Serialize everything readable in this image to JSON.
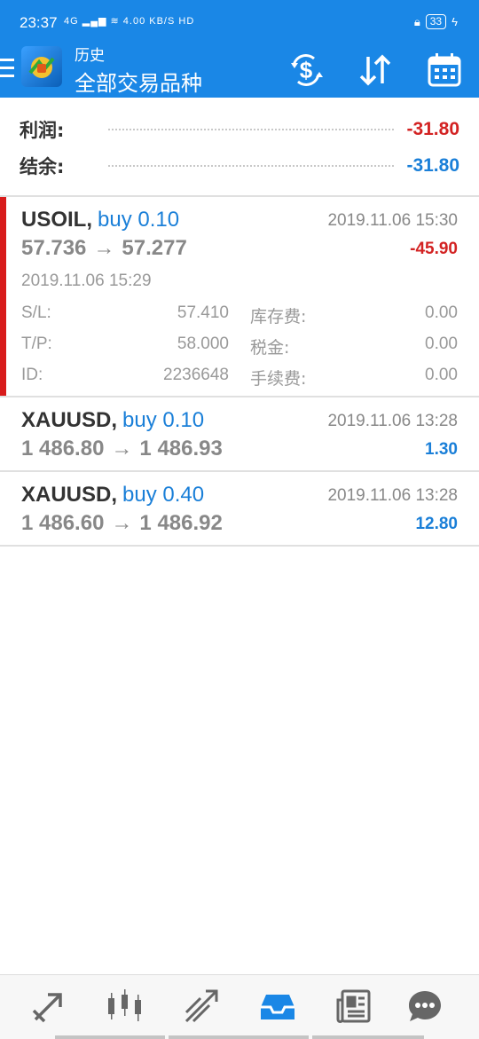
{
  "status_bar": {
    "time": "23:37",
    "net": "4G",
    "speed": "4.00 KB/S",
    "hd": "HD",
    "battery": "33"
  },
  "app_bar": {
    "subtitle": "历史",
    "title": "全部交易品种"
  },
  "icons": {
    "menu": "menu-icon",
    "logo": "metatrader-logo-icon",
    "currency": "currency-exchange-icon",
    "sort": "sort-arrows-icon",
    "calendar": "calendar-icon"
  },
  "summary": {
    "profit_label": "利润:",
    "profit_value": "-31.80",
    "balance_label": "结余:",
    "balance_value": "-31.80"
  },
  "trades": [
    {
      "symbol": "USOIL,",
      "type": "buy 0.10",
      "close_time": "2019.11.06 15:30",
      "open_price": "57.736",
      "arrow": "→",
      "close_price": "57.277",
      "profit": "-45.90",
      "expanded": true,
      "open_time": "2019.11.06 15:29",
      "sl_label": "S/L:",
      "sl_value": "57.410",
      "tp_label": "T/P:",
      "tp_value": "58.000",
      "id_label": "ID:",
      "id_value": "2236648",
      "swap_label": "库存费:",
      "swap_value": "0.00",
      "tax_label": "税金:",
      "tax_value": "0.00",
      "commission_label": "手续费:",
      "commission_value": "0.00"
    },
    {
      "symbol": "XAUUSD,",
      "type": "buy 0.10",
      "close_time": "2019.11.06 13:28",
      "open_price": "1 486.80",
      "arrow": "→",
      "close_price": "1 486.93",
      "profit": "1.30",
      "expanded": false
    },
    {
      "symbol": "XAUUSD,",
      "type": "buy 0.40",
      "close_time": "2019.11.06 13:28",
      "open_price": "1 486.60",
      "arrow": "→",
      "close_price": "1 486.92",
      "profit": "12.80",
      "expanded": false
    }
  ],
  "bottom_nav": {
    "items": [
      "quotes-icon",
      "chart-candles-icon",
      "trade-icon",
      "history-inbox-icon",
      "news-icon",
      "chat-icon"
    ],
    "active": "history-inbox-icon"
  },
  "colors": {
    "brand": "#1a87e6",
    "negative": "#d32323",
    "positive": "#1a7fd8",
    "accent_bar": "#d81b1b"
  }
}
